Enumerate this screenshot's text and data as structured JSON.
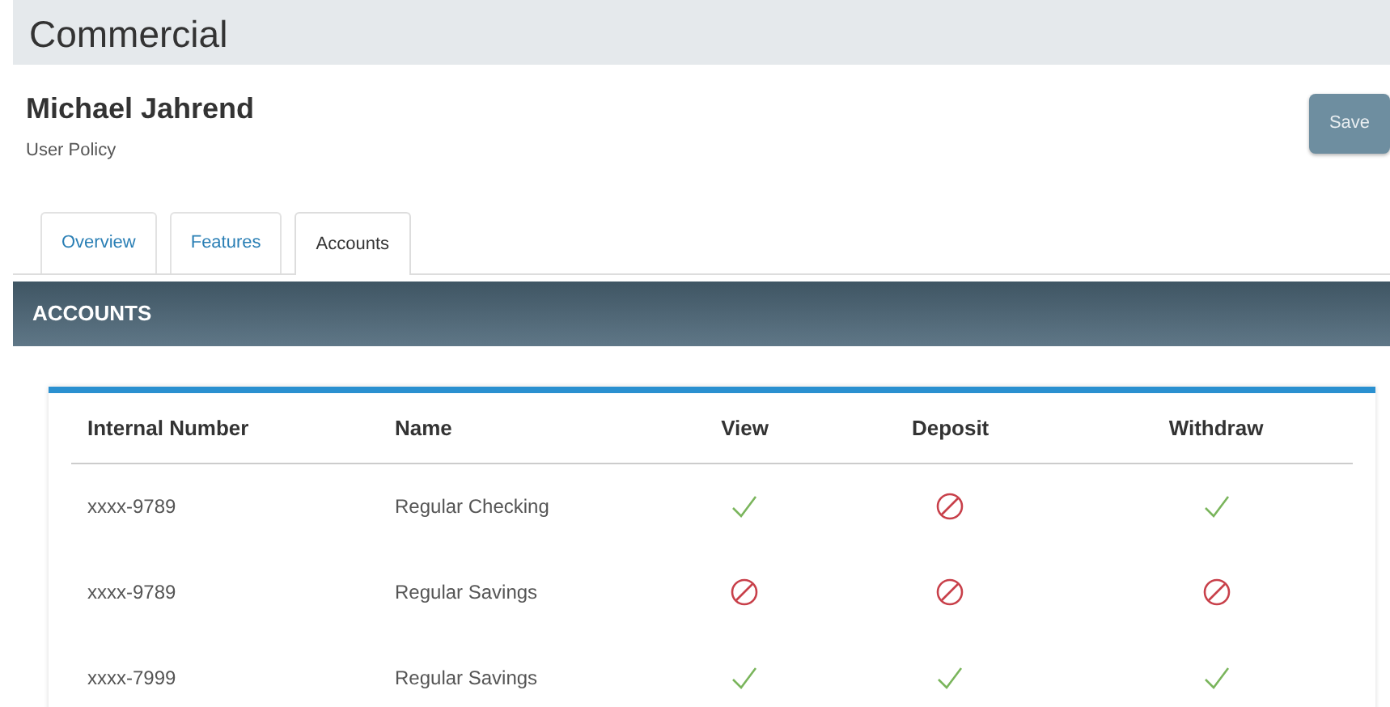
{
  "app_title": "Commercial",
  "user": {
    "name": "Michael Jahrend",
    "subtitle": "User Policy"
  },
  "save_button": "Save",
  "tabs": [
    {
      "label": "Overview",
      "selected": false
    },
    {
      "label": "Features",
      "selected": false
    },
    {
      "label": "Accounts",
      "selected": true
    }
  ],
  "section_title": "ACCOUNTS",
  "table": {
    "columns": [
      "Internal Number",
      "Name",
      "View",
      "Deposit",
      "Withdraw"
    ],
    "rows": [
      {
        "number": "xxxx-9789",
        "name": "Regular Checking",
        "view": true,
        "deposit": false,
        "withdraw": true
      },
      {
        "number": "xxxx-9789",
        "name": "Regular Savings",
        "view": false,
        "deposit": false,
        "withdraw": false
      },
      {
        "number": "xxxx-7999",
        "name": "Regular Savings",
        "view": true,
        "deposit": true,
        "withdraw": true
      }
    ]
  }
}
